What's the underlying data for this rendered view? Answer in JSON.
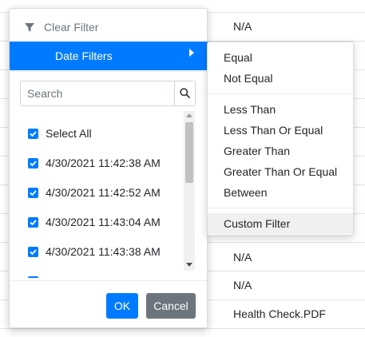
{
  "background_table": {
    "cells": [
      "N/A",
      "N/A",
      "N/A",
      "Health Check.PDF"
    ]
  },
  "filter_popup": {
    "clear_filter_label": "Clear Filter",
    "clear_filter_icon": "filter-icon",
    "date_filters_label": "Date Filters",
    "search": {
      "placeholder": "Search",
      "value": "",
      "icon": "search-icon"
    },
    "items": [
      {
        "label": "Select All",
        "checked": true
      },
      {
        "label": "4/30/2021 11:42:38 AM",
        "checked": true
      },
      {
        "label": "4/30/2021 11:42:52 AM",
        "checked": true
      },
      {
        "label": "4/30/2021 11:43:04 AM",
        "checked": true
      },
      {
        "label": "4/30/2021 11:43:38 AM",
        "checked": true
      }
    ],
    "ok_label": "OK",
    "cancel_label": "Cancel",
    "accent_color": "#007bff",
    "cancel_color": "#6c757d"
  },
  "date_submenu": {
    "group1": [
      "Equal",
      "Not Equal"
    ],
    "group2": [
      "Less Than",
      "Less Than Or Equal",
      "Greater Than",
      "Greater Than Or Equal",
      "Between"
    ],
    "group3": [
      "Custom Filter"
    ],
    "highlighted": "Custom Filter"
  }
}
